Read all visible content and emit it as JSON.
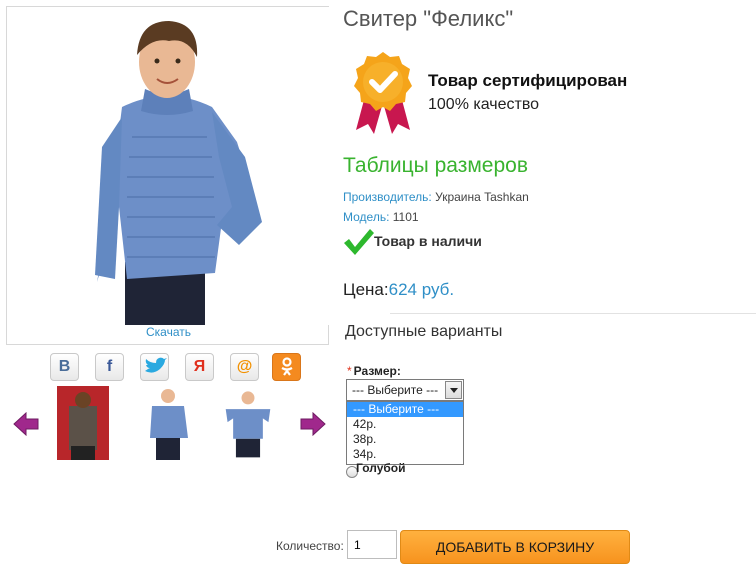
{
  "product": {
    "title": "Свитер \"Феликс\"",
    "download_label": "Скачать",
    "certificate": {
      "title": "Товар сертифицирован",
      "subtitle": "100% качество"
    },
    "size_tables_link": "Таблицы размеров",
    "manufacturer": {
      "key": "Производитель:",
      "value": "Украина Tashkan"
    },
    "model": {
      "key": "Модель:",
      "value": "1101"
    },
    "stock_status": "Товар в наличи",
    "price": {
      "label": "Цена:",
      "value": "624 руб."
    }
  },
  "social": [
    {
      "icon": "vkontakte-icon",
      "glyph": "В",
      "color": "#4a6d99"
    },
    {
      "icon": "facebook-icon",
      "glyph": "f",
      "color": "#3b5998"
    },
    {
      "icon": "twitter-icon",
      "glyph": "",
      "color": "#2aa9e0"
    },
    {
      "icon": "yandex-icon",
      "glyph": "Я",
      "color": "#e0301e"
    },
    {
      "icon": "mail-ru-icon",
      "glyph": "@",
      "color": "#f29100"
    },
    {
      "icon": "odnoklassniki-icon",
      "glyph": "",
      "color": "#f48a1f"
    }
  ],
  "options": {
    "header": "Доступные варианты",
    "size_label": "Размер:",
    "required_mark": "*",
    "select_value": "--- Выберите ---",
    "dropdown_options": [
      "--- Выберите ---",
      "42р.",
      "38р.",
      "34р."
    ],
    "color_option": "Голубой"
  },
  "cart": {
    "quantity_label": "Количество:",
    "quantity_value": "1",
    "add_button": "ДОБАВИТЬ В КОРЗИНУ"
  },
  "colors": {
    "accent_blue": "#2f8fc7",
    "green": "#39b32f",
    "button_orange": "#f7931e",
    "arrow_purple": "#a0288c"
  }
}
